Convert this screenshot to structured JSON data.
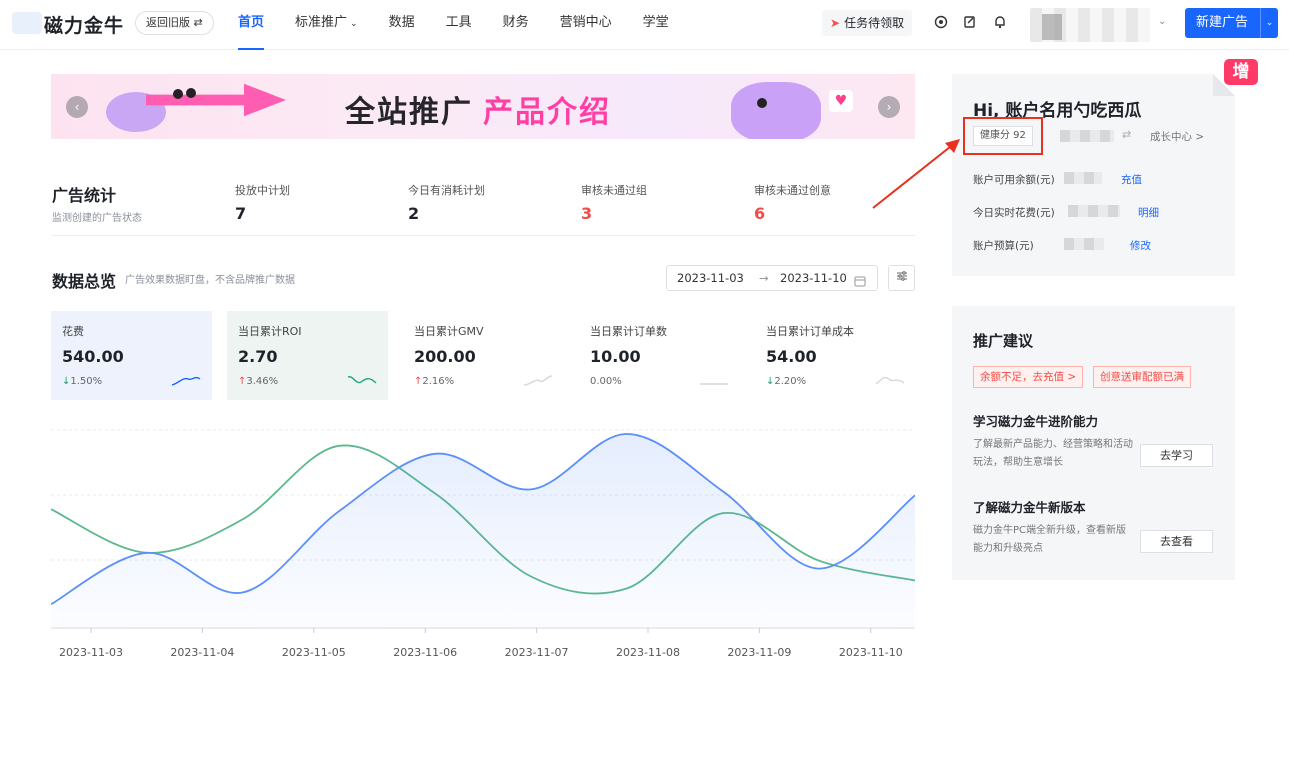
{
  "brand": {
    "name": "磁力金牛",
    "old_version": "返回旧版 ⇄"
  },
  "nav": [
    {
      "label": "首页",
      "active": true
    },
    {
      "label": "标准推广",
      "dropdown": true
    },
    {
      "label": "数据"
    },
    {
      "label": "工具"
    },
    {
      "label": "财务"
    },
    {
      "label": "营销中心"
    },
    {
      "label": "学堂"
    }
  ],
  "topbar": {
    "task_label": "任务待领取",
    "new_ad_label": "新建广告"
  },
  "banner": {
    "title_a": "全站推广",
    "title_b": "产品介绍"
  },
  "ad_stats": {
    "title": "广告统计",
    "subtitle": "监测创建的广告状态",
    "items": [
      {
        "label": "投放中计划",
        "value": "7",
        "alert": false
      },
      {
        "label": "今日有消耗计划",
        "value": "2",
        "alert": false
      },
      {
        "label": "审核未通过组",
        "value": "3",
        "alert": true
      },
      {
        "label": "审核未通过创意",
        "value": "6",
        "alert": true
      }
    ]
  },
  "overview": {
    "title": "数据总览",
    "subtitle": "广告效果数据盯盘，不含品牌推广数据",
    "date_start": "2023-11-03",
    "date_end": "2023-11-10",
    "date_sep": "→",
    "metrics": [
      {
        "label": "花费",
        "value": "540.00",
        "change": "1.50%",
        "dir": "down",
        "arrow": "↓",
        "highlight": "blue",
        "spark_color": "#1966ff"
      },
      {
        "label": "当日累计ROI",
        "value": "2.70",
        "change": "3.46%",
        "dir": "up",
        "arrow": "↑",
        "highlight": "green",
        "spark_color": "#22a77a"
      },
      {
        "label": "当日累计GMV",
        "value": "200.00",
        "change": "2.16%",
        "dir": "up",
        "arrow": "↑",
        "highlight": "",
        "spark_color": "#d5d7dc"
      },
      {
        "label": "当日累计订单数",
        "value": "10.00",
        "change": "0.00%",
        "dir": "flat",
        "arrow": "",
        "highlight": "",
        "spark_color": "#d5d7dc"
      },
      {
        "label": "当日累计订单成本",
        "value": "54.00",
        "change": "2.20%",
        "dir": "down",
        "arrow": "↓",
        "highlight": "",
        "spark_color": "#d5d7dc"
      }
    ]
  },
  "chart_data": {
    "type": "line",
    "x": [
      "2023-11-03",
      "2023-11-04",
      "2023-11-05",
      "2023-11-06",
      "2023-11-07",
      "2023-11-08",
      "2023-11-09",
      "2023-11-10"
    ],
    "series": [
      {
        "values": [
          12,
          38,
          18,
          59,
          88,
          70,
          98,
          69,
          30,
          67
        ],
        "color": "#5b8ff9",
        "fill": true
      },
      {
        "values": [
          60,
          38,
          55,
          92,
          68,
          26,
          20,
          58,
          34,
          24
        ],
        "color": "#5ab88c",
        "fill": false
      }
    ],
    "ylim": [
      0,
      100
    ],
    "grid": true
  },
  "account": {
    "greeting": "Hi, 账户名用勺吃西瓜",
    "health": "健康分 92",
    "growth": "成长中心 >",
    "balance_label": "账户可用余额(元)",
    "balance_link": "充值",
    "spend_label": "今日实时花费(元)",
    "spend_link": "明细",
    "budget_label": "账户预算(元)",
    "budget_link": "修改",
    "corner_badge": "增"
  },
  "suggest": {
    "title": "推广建议",
    "tags": [
      "余额不足，去充值 >",
      "创意送审配额已满"
    ],
    "items": [
      {
        "title": "学习磁力金牛进阶能力",
        "desc": "了解最新产品能力、经营策略和活动玩法，帮助生意增长",
        "button": "去学习"
      },
      {
        "title": "了解磁力金牛新版本",
        "desc": "磁力金牛PC端全新升级，查看新版能力和升级亮点",
        "button": "去查看"
      }
    ]
  }
}
